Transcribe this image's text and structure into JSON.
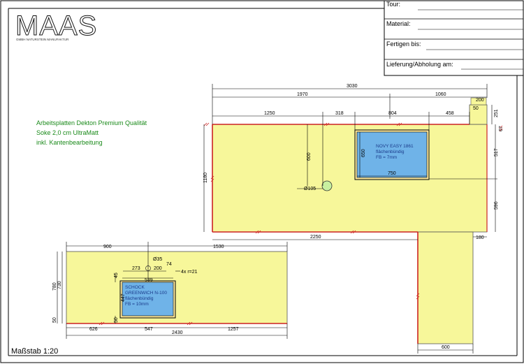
{
  "title_block": {
    "tour_label": "Tour:",
    "material_label": "Material:",
    "fertigen_label": "Fertigen bis:",
    "lieferung_label": "Lieferung/Abholung am:"
  },
  "logo": {
    "text": "MAAS",
    "subtitle": "GMBH NATURSTEIN MANUFAKTUR"
  },
  "notes": {
    "line1": "Arbeitsplatten Dekton Premium Qualität",
    "line2": "Soke 2,0 cm UltraMatt",
    "line3": "inkl. Kantenbearbeitung"
  },
  "scale": "Maßstab 1:20",
  "colors": {
    "counter": "#f7f79a",
    "sink": "#6fb3e8",
    "edge": "#cc2222",
    "note": "#1a8a1a"
  },
  "sink_upper": {
    "line1": "NOVY EASY 1861",
    "line2": "flächenbündig",
    "line3": "FB = 7mm"
  },
  "sink_lower": {
    "line1": "SCHOCK",
    "line2": "GREENWICH N-100",
    "line3": "flächenbündig",
    "line4": "FB = 10mm"
  },
  "dims": {
    "d3030": "3030",
    "d1970": "1970",
    "d1060": "1060",
    "d200a": "200",
    "d50": "50",
    "d251": "251",
    "d67": "67",
    "d1250": "1250",
    "d318": "318",
    "d804": "804",
    "d458": "458",
    "d517": "517",
    "d1180": "1180",
    "d600v": "600",
    "d650": "650",
    "d750": "750",
    "d105": "Ø105",
    "d596": "596",
    "d2250": "2250",
    "d180": "180",
    "d900": "900",
    "d1530": "1530",
    "d35": "Ø35",
    "d273": "273",
    "d200b": "200",
    "d74": "74",
    "d4xr": "4x r=21",
    "d539": "539",
    "d45": "45",
    "d780": "780",
    "d730": "730",
    "d447": "447",
    "d50b": "50",
    "d50c": "50",
    "d626": "626",
    "d547": "547",
    "d1257": "1257",
    "d2430": "2430",
    "d600h": "600"
  }
}
